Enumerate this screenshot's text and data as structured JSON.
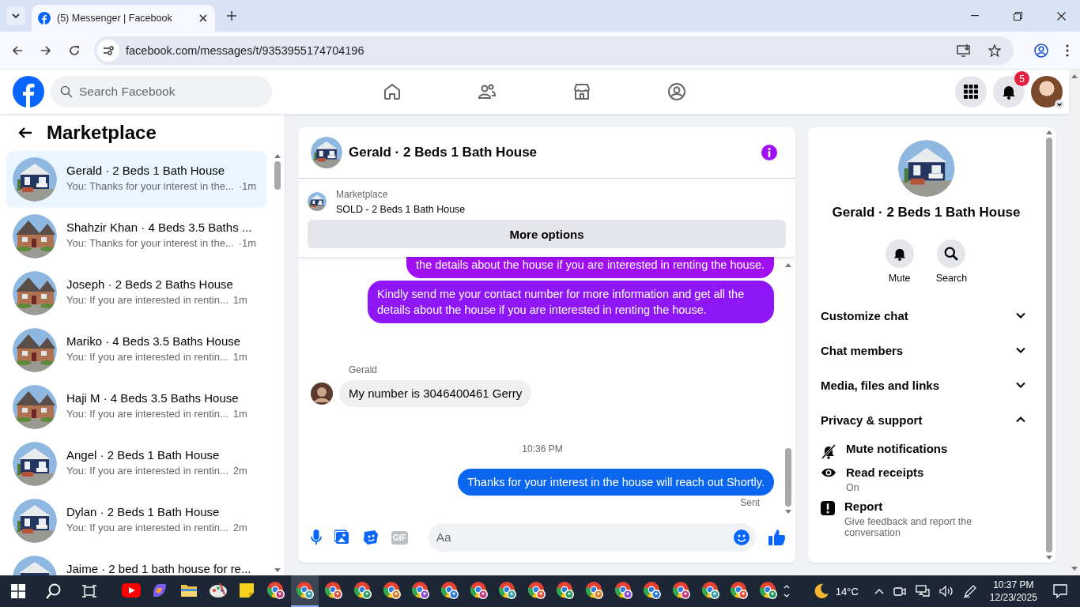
{
  "browser": {
    "tab_title": "(5) Messenger | Facebook",
    "url": "facebook.com/messages/t/9353955174704196"
  },
  "header": {
    "search": {
      "placeholder": "Search Facebook"
    },
    "notification_count": "5"
  },
  "sidebar": {
    "title": "Marketplace",
    "conversations": [
      {
        "title": "Gerald · 2 Beds 1 Bath House",
        "preview": "You: Thanks for your interest in the...",
        "time": "·1m",
        "selected": true
      },
      {
        "title": "Shahzir Khan · 4 Beds 3.5 Baths ...",
        "preview": "You: Thanks for your interest in the...",
        "time": "·1m",
        "selected": false
      },
      {
        "title": "Joseph · 2 Beds 2 Baths House",
        "preview": "You: If you are interested in rentin...",
        "time": "1m",
        "selected": false
      },
      {
        "title": "Mariko · 4 Beds 3.5 Baths House",
        "preview": "You: If you are interested in rentin...",
        "time": "1m",
        "selected": false
      },
      {
        "title": "Haji M · 4 Beds 3.5 Baths House",
        "preview": "You: If you are interested in rentin...",
        "time": "1m",
        "selected": false
      },
      {
        "title": "Angel · 2 Beds 1 Bath House",
        "preview": "You: If you are interested in rentin...",
        "time": "2m",
        "selected": false
      },
      {
        "title": "Dylan · 2 Beds 1 Bath House",
        "preview": "You: If you are interested in rentin...",
        "time": "2m",
        "selected": false
      },
      {
        "title": "Jaime · 2 bed 1 bath house for re...",
        "selected": false
      }
    ]
  },
  "chat": {
    "title": "Gerald · 2 Beds 1 Bath House",
    "listing": {
      "label": "Marketplace",
      "title": "SOLD - 2 Beds 1 Bath House"
    },
    "more_button": "More options",
    "messages": [
      {
        "kind": "outgoing",
        "text": "the details about the house if you are interested in renting the house.",
        "color": "#a20ef2"
      },
      {
        "kind": "outgoing",
        "text": "Kindly send me your contact number for more information and get all the details about the house if you are interested in renting the house.",
        "color": "#8f17f7"
      },
      {
        "kind": "incoming",
        "sender": "Gerald",
        "text": "My number is 3046400461 Gerry"
      },
      {
        "kind": "time",
        "text": "10:36 PM"
      },
      {
        "kind": "outgoing",
        "text": "Thanks for your interest in the house will reach out Shortly.",
        "color": "#0a66ef",
        "status": "Sent"
      }
    ],
    "composer": {
      "gif_label": "GIF",
      "placeholder": "Aa"
    }
  },
  "details": {
    "title": "Gerald · 2 Beds 1 Bath House",
    "actions": [
      {
        "kind": "bell",
        "label": "Mute"
      },
      {
        "kind": "search",
        "label": "Search"
      }
    ],
    "sections": [
      {
        "label": "Customize chat",
        "expanded": false
      },
      {
        "label": "Chat members",
        "expanded": false
      },
      {
        "label": "Media, files and links",
        "expanded": false
      },
      {
        "label": "Privacy & support",
        "expanded": true
      }
    ],
    "privacy_items": [
      {
        "kind": "mute",
        "label": "Mute notifications"
      },
      {
        "kind": "eye",
        "label": "Read receipts",
        "sub": "On"
      },
      {
        "kind": "report",
        "label": "Report",
        "sub": "Give feedback and report the conversation"
      }
    ]
  },
  "taskbar": {
    "apps": [
      {
        "kind": "video",
        "selected": false
      },
      {
        "kind": "copilot",
        "selected": false
      },
      {
        "kind": "folder",
        "selected": false
      },
      {
        "kind": "paint",
        "selected": false
      },
      {
        "kind": "note",
        "selected": false
      },
      {
        "kind": "browser",
        "selected": false
      },
      {
        "kind": "browser",
        "selected": true
      },
      {
        "kind": "browser",
        "selected": false
      },
      {
        "kind": "browser",
        "selected": false
      },
      {
        "kind": "browser",
        "selected": false
      },
      {
        "kind": "browser",
        "selected": false
      },
      {
        "kind": "browser",
        "selected": false
      },
      {
        "kind": "browser",
        "selected": false
      },
      {
        "kind": "browser",
        "selected": false
      },
      {
        "kind": "browser",
        "selected": false
      },
      {
        "kind": "browser",
        "selected": false
      },
      {
        "kind": "browser",
        "selected": false
      },
      {
        "kind": "browser",
        "selected": false
      },
      {
        "kind": "browser",
        "selected": false
      },
      {
        "kind": "browser",
        "selected": false
      },
      {
        "kind": "browser",
        "selected": false
      },
      {
        "kind": "browser",
        "selected": false
      },
      {
        "kind": "browser",
        "selected": false
      }
    ],
    "temperature": "14°C",
    "time": "10:37 PM",
    "date": "12/23/2025"
  }
}
